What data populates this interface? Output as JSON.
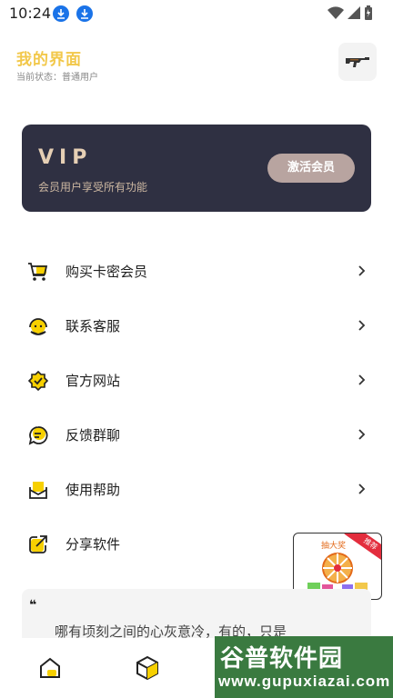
{
  "status_bar": {
    "time": "10:24"
  },
  "header": {
    "title": "我的界面",
    "subtitle": "当前状态：普通用户"
  },
  "vip": {
    "title": "VIP",
    "description": "会员用户享受所有功能",
    "button": "激活会员"
  },
  "menu": [
    {
      "label": "购买卡密会员",
      "icon": "cart-icon"
    },
    {
      "label": "联系客服",
      "icon": "customer-service-icon"
    },
    {
      "label": "官方网站",
      "icon": "badge-icon"
    },
    {
      "label": "反馈群聊",
      "icon": "chat-icon"
    },
    {
      "label": "使用帮助",
      "icon": "mail-icon"
    },
    {
      "label": "分享软件",
      "icon": "share-icon"
    }
  ],
  "promo": {
    "title": "抽大奖",
    "ribbon": "推荐"
  },
  "quote": {
    "text": "哪有顷刻之间的心灰意冷，有的，只是"
  },
  "watermark": {
    "name": "谷普软件园",
    "url": "www.gupuxiazai.com"
  },
  "colors": {
    "accent": "#f2c84b",
    "vip_bg": "#2f3042",
    "vip_gold": "#e6cfb4",
    "icon_yellow": "#f7d000"
  }
}
